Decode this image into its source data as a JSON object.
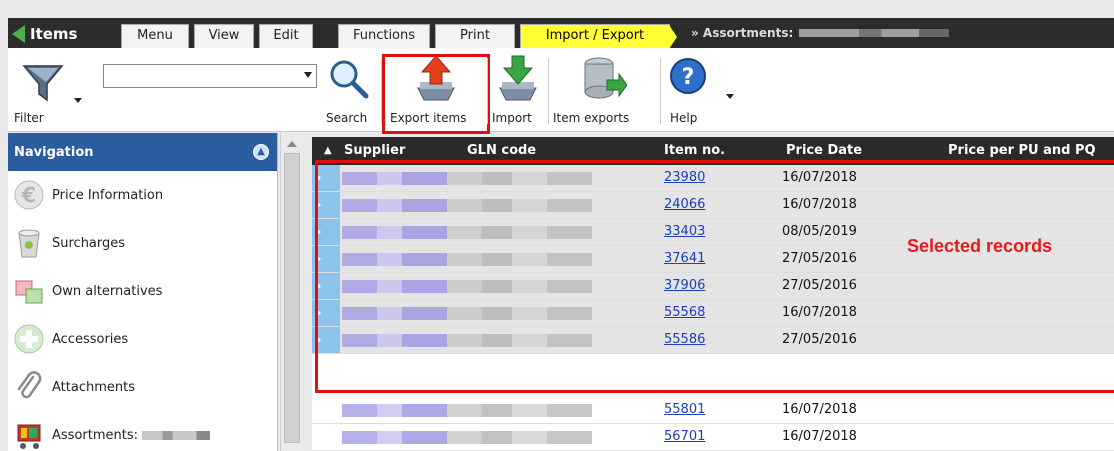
{
  "app": {
    "title": "Items"
  },
  "tabs": [
    {
      "label": "Menu"
    },
    {
      "label": "View"
    },
    {
      "label": "Edit"
    },
    {
      "label": "Functions"
    },
    {
      "label": "Print"
    },
    {
      "label": "Import / Export",
      "active": true
    }
  ],
  "breadcrumb": "» Assortments:",
  "toolbar": {
    "filter_label": "Filter",
    "search_label": "Search",
    "export_items_label": "Export items",
    "import_label": "Import",
    "item_exports_label": "Item exports",
    "help_label": "Help",
    "search_value": ""
  },
  "navigation": {
    "title": "Navigation",
    "items": [
      {
        "label": "Price Information",
        "icon": "euro-icon"
      },
      {
        "label": "Surcharges",
        "icon": "recycle-bin-icon"
      },
      {
        "label": "Own alternatives",
        "icon": "alternatives-icon"
      },
      {
        "label": "Accessories",
        "icon": "plus-circle-icon"
      },
      {
        "label": "Attachments",
        "icon": "paperclip-icon"
      },
      {
        "label": "Assortments:",
        "icon": "shopping-cart-icon"
      }
    ]
  },
  "grid": {
    "columns": [
      "Supplier",
      "GLN code",
      "Item no.",
      "Price Date",
      "Price per PU and PQ"
    ],
    "rows": [
      {
        "item_no": "23980",
        "price_date": "16/07/2018",
        "selected": true
      },
      {
        "item_no": "24066",
        "price_date": "16/07/2018",
        "selected": true
      },
      {
        "item_no": "33403",
        "price_date": "08/05/2019",
        "selected": true
      },
      {
        "item_no": "37641",
        "price_date": "27/05/2016",
        "selected": true
      },
      {
        "item_no": "37906",
        "price_date": "27/05/2016",
        "selected": true
      },
      {
        "item_no": "55568",
        "price_date": "16/07/2018",
        "selected": true
      },
      {
        "item_no": "55586",
        "price_date": "27/05/2016",
        "selected": true
      },
      {
        "item_no": "55801",
        "price_date": "16/07/2018",
        "selected": false
      },
      {
        "item_no": "56701",
        "price_date": "16/07/2018",
        "selected": false
      }
    ]
  },
  "annotation": {
    "selected_records": "Selected records"
  },
  "colors": {
    "active_tab": "#ffff33",
    "highlight": "#e01010",
    "header_blue": "#2a5c9e",
    "selection_marker": "#8cc3ea"
  }
}
